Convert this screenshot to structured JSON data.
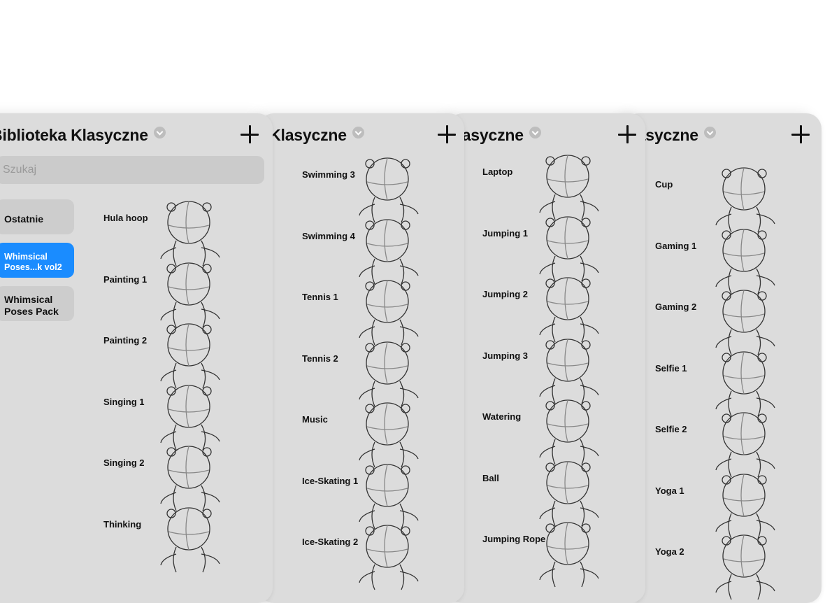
{
  "panels": [
    {
      "title": "Biblioteka Klasyczne",
      "search_placeholder": "Szukaj",
      "sidebar": [
        {
          "label": "Ostatnie",
          "active": false
        },
        {
          "label": "Whimsical\nPoses...k vol2",
          "active": true
        },
        {
          "label": "Whimsical\nPoses Pack",
          "active": false
        }
      ],
      "items": [
        "Hula hoop",
        "Painting 1",
        "Painting 2",
        "Singing 1",
        "Singing 2",
        "Thinking"
      ]
    },
    {
      "title": "Biblioteka Klasyczne",
      "items": [
        "Swimming 3",
        "Swimming 4",
        "Tennis 1",
        "Tennis 2",
        "Music",
        "Ice-Skating 1",
        "Ice-Skating 2"
      ]
    },
    {
      "title": "Biblioteka Klasyczne",
      "items": [
        "Laptop",
        "Jumping 1",
        "Jumping 2",
        "Jumping 3",
        "Watering",
        "Ball",
        "Jumping Rope"
      ]
    },
    {
      "title": "Biblioteka Klasyczne",
      "items": [
        "Cup",
        "Gaming 1",
        "Gaming 2",
        "Selfie 1",
        "Selfie 2",
        "Yoga 1",
        "Yoga 2"
      ]
    }
  ],
  "icons": {
    "dropdown": "chevron-down-icon",
    "add": "plus-icon",
    "thumbnail": "pose-figure-icon"
  },
  "colors": {
    "panel_bg": "#dcdcdc",
    "accent": "#1a8cff",
    "search_bg": "#cbcbcb"
  }
}
